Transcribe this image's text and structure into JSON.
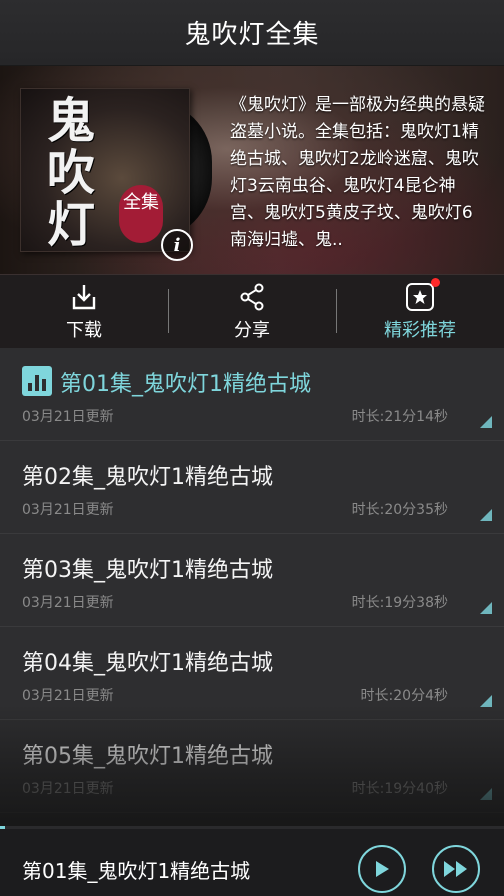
{
  "header": {
    "title": "鬼吹灯全集"
  },
  "album": {
    "cover_title": "鬼吹灯",
    "cover_badge": "全集",
    "info_icon": "i",
    "description": "《鬼吹灯》是一部极为经典的悬疑盗墓小说。全集包括：鬼吹灯1精绝古城、鬼吹灯2龙岭迷窟、鬼吹灯3云南虫谷、鬼吹灯4昆仑神宫、鬼吹灯5黄皮子坟、鬼吹灯6南海归墟、鬼.."
  },
  "actions": [
    {
      "label": "下载",
      "icon": "download-icon"
    },
    {
      "label": "分享",
      "icon": "share-icon"
    },
    {
      "label": "精彩推荐",
      "icon": "star-icon",
      "notification": true
    }
  ],
  "episodes": [
    {
      "title": "第01集_鬼吹灯1精绝古城",
      "updated": "03月21日更新",
      "duration": "时长:21分14秒",
      "playing": true
    },
    {
      "title": "第02集_鬼吹灯1精绝古城",
      "updated": "03月21日更新",
      "duration": "时长:20分35秒",
      "playing": false
    },
    {
      "title": "第03集_鬼吹灯1精绝古城",
      "updated": "03月21日更新",
      "duration": "时长:19分38秒",
      "playing": false
    },
    {
      "title": "第04集_鬼吹灯1精绝古城",
      "updated": "03月21日更新",
      "duration": "时长:20分4秒",
      "playing": false
    },
    {
      "title": "第05集_鬼吹灯1精绝古城",
      "updated": "03月21日更新",
      "duration": "时长:19分40秒",
      "playing": false
    }
  ],
  "player": {
    "now_playing": "第01集_鬼吹灯1精绝古城",
    "progress": 0.01
  },
  "colors": {
    "accent": "#7fd6dc",
    "background": "#2b2b2d",
    "badge": "#a31c36",
    "notification": "#ff2a2a"
  }
}
